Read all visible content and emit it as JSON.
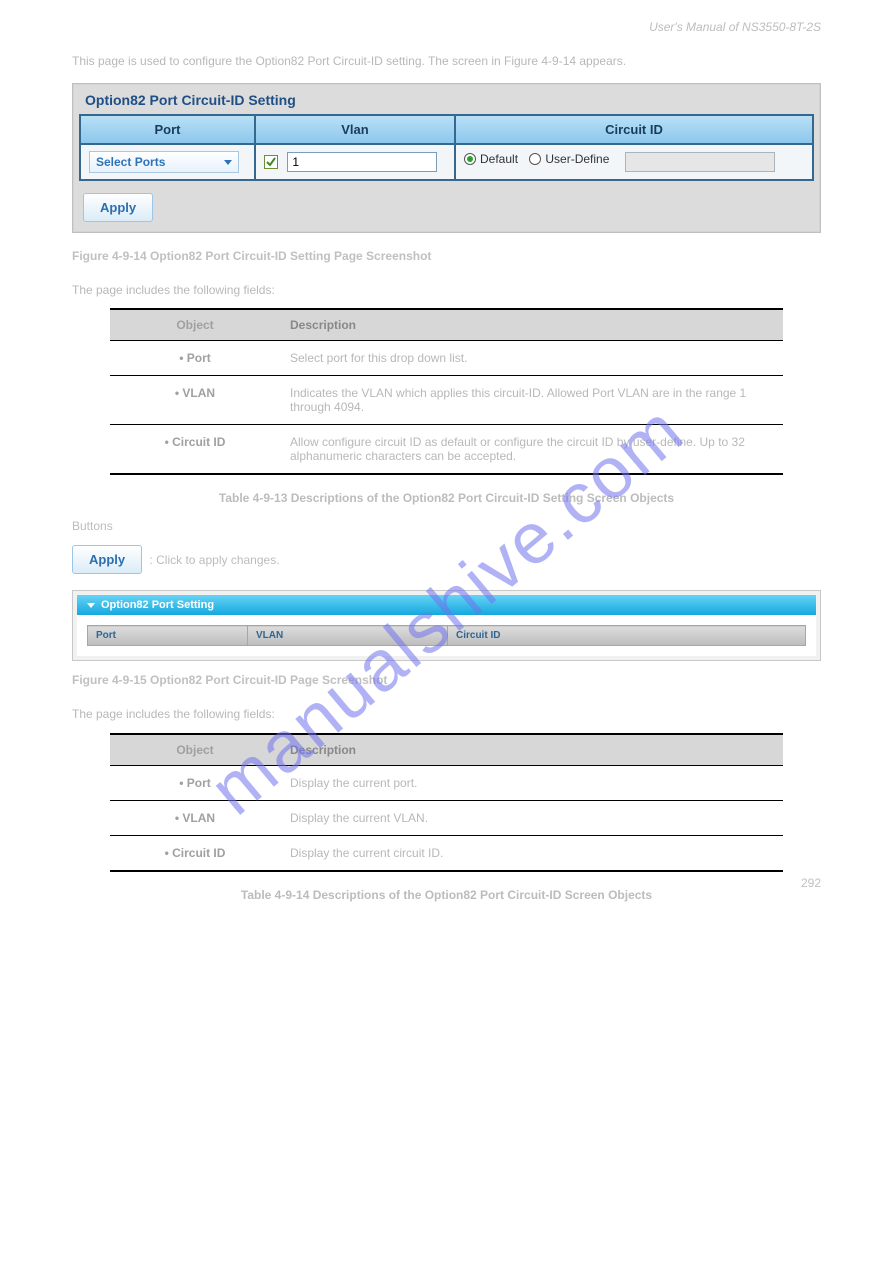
{
  "header": {
    "left": "User's Manual of NS3550-8T-2S",
    "right_italic": "User's Manual of NS3550-8T-2S"
  },
  "intro_text": "This page is used to configure the Option82 Port Circuit-ID setting. The screen in Figure 4-9-14 appears.",
  "panel1": {
    "title": "Option82 Port Circuit-ID Setting",
    "headers": {
      "port": "Port",
      "vlan": "Vlan",
      "cid": "Circuit ID"
    },
    "select_ports_label": "Select Ports",
    "vlan_checked": true,
    "vlan_value": "1",
    "radio_default": "Default",
    "radio_userdefine": "User-Define",
    "userdefine_value": "",
    "apply_label": "Apply"
  },
  "figure1_caption": "Figure 4-9-14 Option82 Port Circuit-ID Setting Page Screenshot",
  "desc_intro": "The page includes the following fields:",
  "desc_table1": {
    "headers": {
      "object": "Object",
      "description": "Description"
    },
    "rows": [
      {
        "object": "• Port",
        "description": "Select port for this drop down list."
      },
      {
        "object": "• VLAN",
        "description": "Indicates the VLAN which applies this circuit-ID. Allowed Port VLAN are in the range 1 through 4094."
      },
      {
        "object": "• Circuit ID",
        "description": "Allow configure circuit ID as default or configure the circuit ID by user-define. Up to 32 alphanumeric characters can be accepted."
      }
    ]
  },
  "table1_caption": "Table 4-9-13 Descriptions of the Option82 Port Circuit-ID Setting Screen Objects",
  "buttons_text": "Buttons",
  "apply_desc": ": Click to apply changes.",
  "apply_label_standalone": "Apply",
  "panel2": {
    "title": "Option82 Port Setting",
    "headers": {
      "port": "Port",
      "vlan": "VLAN",
      "cid": "Circuit ID"
    }
  },
  "figure2_caption": "Figure 4-9-15 Option82 Port Circuit-ID Page Screenshot",
  "desc_intro2": "The page includes the following fields:",
  "desc_table2": {
    "headers": {
      "object": "Object",
      "description": "Description"
    },
    "rows": [
      {
        "object": "• Port",
        "description": "Display the current port."
      },
      {
        "object": "• VLAN",
        "description": "Display the current VLAN."
      },
      {
        "object": "• Circuit ID",
        "description": "Display the current circuit ID."
      }
    ]
  },
  "table2_caption": "Table 4-9-14 Descriptions of the Option82 Port Circuit-ID Screen Objects",
  "watermark": "manualshive.com",
  "footer": "292"
}
